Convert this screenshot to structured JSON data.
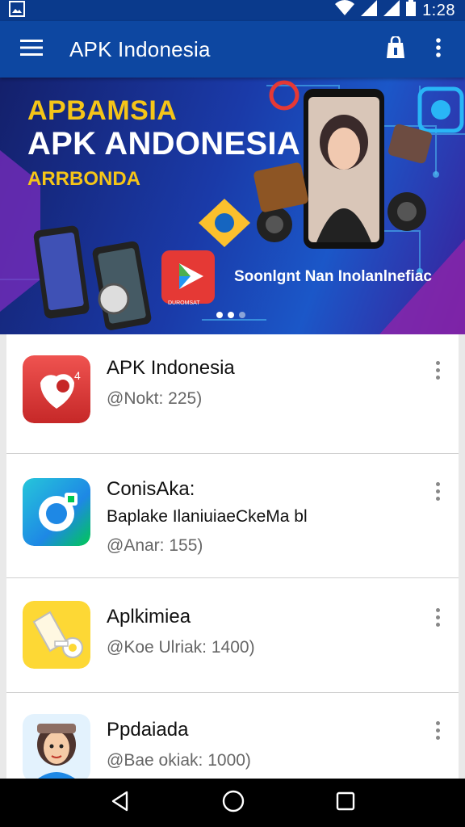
{
  "status_bar": {
    "time": "1:28"
  },
  "app_bar": {
    "title": "APK Indonesia"
  },
  "banner": {
    "line1": "APBAMSIA",
    "line2": "APK ANDONESIA",
    "line3": "ARRBONDA",
    "tagline": "Soonlgnt Nan Inolanlnefiac",
    "store_caption": "DUROMSAT",
    "page_count": 3,
    "active_page": 1
  },
  "apps": [
    {
      "title": "APK Indonesia",
      "meta": "@Nokt: 225)",
      "icon": "heart-shield-icon"
    },
    {
      "title": "ConisAka:",
      "subtitle": "Baplake IlaniuiaeCkeMa bl",
      "meta": "@Anar: 155)",
      "icon": "camera-lens-icon"
    },
    {
      "title": "Aplkimiea",
      "meta": "@Koe Ulriak: 1400)",
      "icon": "key-tool-icon"
    },
    {
      "title": "Ppdaiada",
      "meta": "@Bae okiak: 1000)",
      "icon": "avatar-icon"
    }
  ],
  "colors": {
    "app_bar": "#0d47a1",
    "status_bar": "#0a3a8c",
    "accent_yellow": "#f5c518"
  }
}
